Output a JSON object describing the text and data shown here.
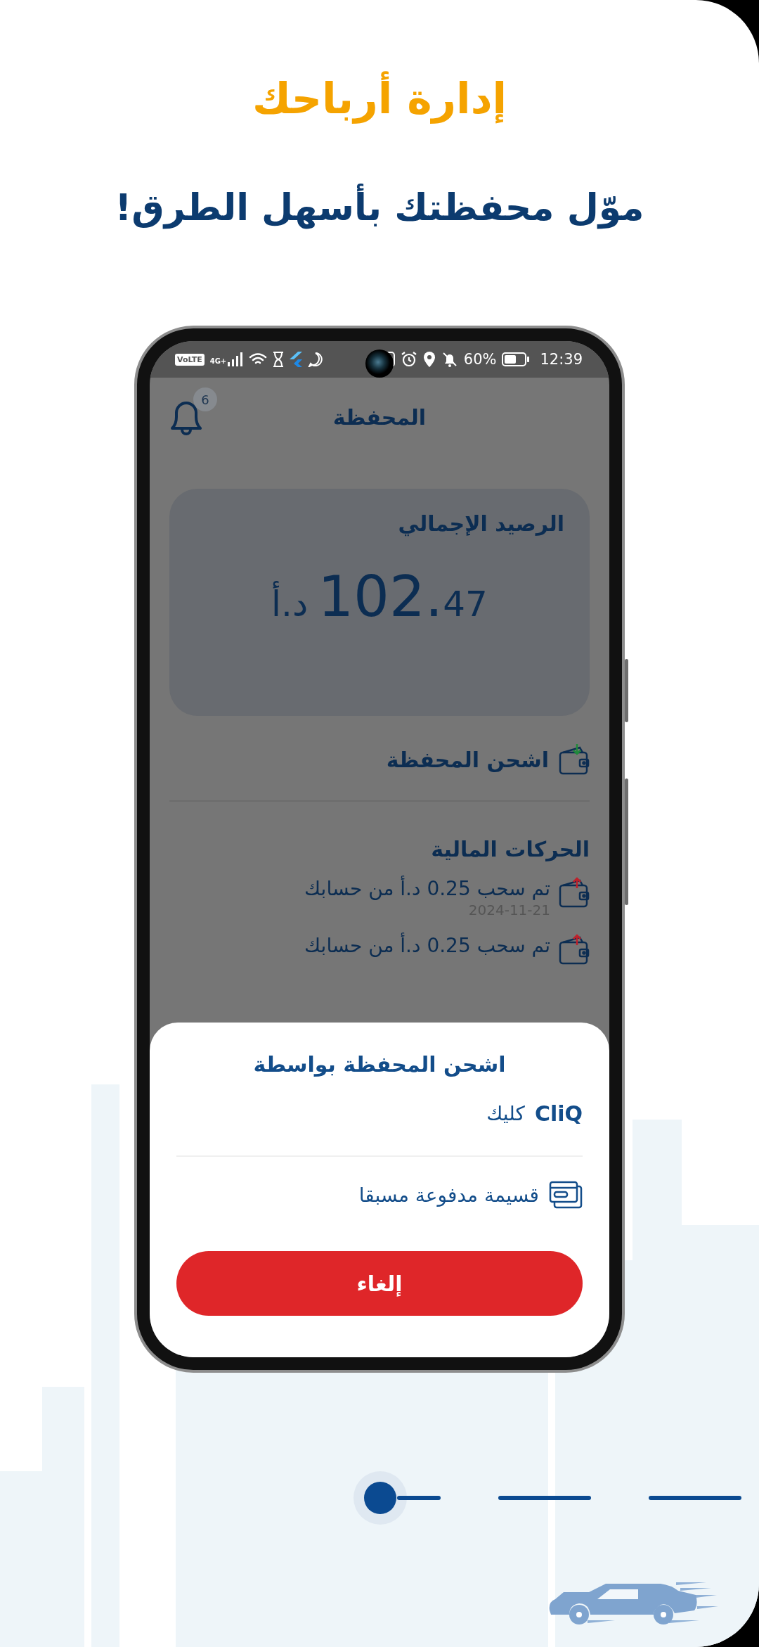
{
  "header": {
    "title": "إدارة أرباحك",
    "subtitle": "موّل محفظتك بأسهل الطرق!"
  },
  "status_bar": {
    "network_badge": "VoLTE",
    "network_type": "4G+",
    "battery": "60%",
    "time": "12:39"
  },
  "app": {
    "title": "المحفظة",
    "notification_count": "6",
    "balance": {
      "label": "الرصيد الإجمالي",
      "amount_whole": "102.",
      "amount_fraction": "47",
      "currency": "د.أ"
    },
    "top_up": "اشحن المحفظة",
    "transactions": {
      "title": "الحركات المالية",
      "items": [
        {
          "kind": "withdrawal",
          "text": "تم سحب 0.25 د.أ من حسابك",
          "date": "2024-11-21"
        },
        {
          "kind": "withdrawal",
          "text": "تم سحب 0.25 د.أ من حسابك"
        }
      ]
    }
  },
  "sheet": {
    "title": "اشحن المحفظة بواسطة",
    "options": [
      {
        "kind": "cliq",
        "logo": "CliQ",
        "label": "كليك"
      },
      {
        "kind": "card",
        "label": "قسيمة مدفوعة مسبقا"
      }
    ],
    "cancel": "إلغاء"
  },
  "indicators": [
    {
      "selected": true
    },
    {
      "selected": false
    },
    {
      "selected": false
    }
  ]
}
